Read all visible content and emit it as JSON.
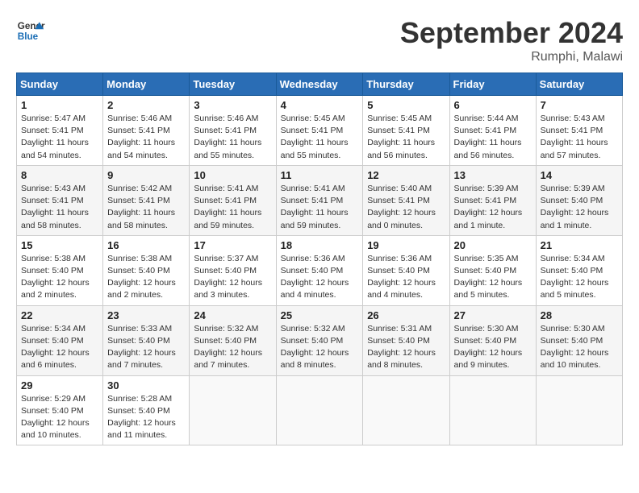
{
  "header": {
    "logo_line1": "General",
    "logo_line2": "Blue",
    "month": "September 2024",
    "location": "Rumphi, Malawi"
  },
  "weekdays": [
    "Sunday",
    "Monday",
    "Tuesday",
    "Wednesday",
    "Thursday",
    "Friday",
    "Saturday"
  ],
  "weeks": [
    [
      {
        "day": 1,
        "sunrise": "5:47 AM",
        "sunset": "5:41 PM",
        "daylight": "11 hours and 54 minutes."
      },
      {
        "day": 2,
        "sunrise": "5:46 AM",
        "sunset": "5:41 PM",
        "daylight": "11 hours and 54 minutes."
      },
      {
        "day": 3,
        "sunrise": "5:46 AM",
        "sunset": "5:41 PM",
        "daylight": "11 hours and 55 minutes."
      },
      {
        "day": 4,
        "sunrise": "5:45 AM",
        "sunset": "5:41 PM",
        "daylight": "11 hours and 55 minutes."
      },
      {
        "day": 5,
        "sunrise": "5:45 AM",
        "sunset": "5:41 PM",
        "daylight": "11 hours and 56 minutes."
      },
      {
        "day": 6,
        "sunrise": "5:44 AM",
        "sunset": "5:41 PM",
        "daylight": "11 hours and 56 minutes."
      },
      {
        "day": 7,
        "sunrise": "5:43 AM",
        "sunset": "5:41 PM",
        "daylight": "11 hours and 57 minutes."
      }
    ],
    [
      {
        "day": 8,
        "sunrise": "5:43 AM",
        "sunset": "5:41 PM",
        "daylight": "11 hours and 58 minutes."
      },
      {
        "day": 9,
        "sunrise": "5:42 AM",
        "sunset": "5:41 PM",
        "daylight": "11 hours and 58 minutes."
      },
      {
        "day": 10,
        "sunrise": "5:41 AM",
        "sunset": "5:41 PM",
        "daylight": "11 hours and 59 minutes."
      },
      {
        "day": 11,
        "sunrise": "5:41 AM",
        "sunset": "5:41 PM",
        "daylight": "11 hours and 59 minutes."
      },
      {
        "day": 12,
        "sunrise": "5:40 AM",
        "sunset": "5:41 PM",
        "daylight": "12 hours and 0 minutes."
      },
      {
        "day": 13,
        "sunrise": "5:39 AM",
        "sunset": "5:41 PM",
        "daylight": "12 hours and 1 minute."
      },
      {
        "day": 14,
        "sunrise": "5:39 AM",
        "sunset": "5:40 PM",
        "daylight": "12 hours and 1 minute."
      }
    ],
    [
      {
        "day": 15,
        "sunrise": "5:38 AM",
        "sunset": "5:40 PM",
        "daylight": "12 hours and 2 minutes."
      },
      {
        "day": 16,
        "sunrise": "5:38 AM",
        "sunset": "5:40 PM",
        "daylight": "12 hours and 2 minutes."
      },
      {
        "day": 17,
        "sunrise": "5:37 AM",
        "sunset": "5:40 PM",
        "daylight": "12 hours and 3 minutes."
      },
      {
        "day": 18,
        "sunrise": "5:36 AM",
        "sunset": "5:40 PM",
        "daylight": "12 hours and 4 minutes."
      },
      {
        "day": 19,
        "sunrise": "5:36 AM",
        "sunset": "5:40 PM",
        "daylight": "12 hours and 4 minutes."
      },
      {
        "day": 20,
        "sunrise": "5:35 AM",
        "sunset": "5:40 PM",
        "daylight": "12 hours and 5 minutes."
      },
      {
        "day": 21,
        "sunrise": "5:34 AM",
        "sunset": "5:40 PM",
        "daylight": "12 hours and 5 minutes."
      }
    ],
    [
      {
        "day": 22,
        "sunrise": "5:34 AM",
        "sunset": "5:40 PM",
        "daylight": "12 hours and 6 minutes."
      },
      {
        "day": 23,
        "sunrise": "5:33 AM",
        "sunset": "5:40 PM",
        "daylight": "12 hours and 7 minutes."
      },
      {
        "day": 24,
        "sunrise": "5:32 AM",
        "sunset": "5:40 PM",
        "daylight": "12 hours and 7 minutes."
      },
      {
        "day": 25,
        "sunrise": "5:32 AM",
        "sunset": "5:40 PM",
        "daylight": "12 hours and 8 minutes."
      },
      {
        "day": 26,
        "sunrise": "5:31 AM",
        "sunset": "5:40 PM",
        "daylight": "12 hours and 8 minutes."
      },
      {
        "day": 27,
        "sunrise": "5:30 AM",
        "sunset": "5:40 PM",
        "daylight": "12 hours and 9 minutes."
      },
      {
        "day": 28,
        "sunrise": "5:30 AM",
        "sunset": "5:40 PM",
        "daylight": "12 hours and 10 minutes."
      }
    ],
    [
      {
        "day": 29,
        "sunrise": "5:29 AM",
        "sunset": "5:40 PM",
        "daylight": "12 hours and 10 minutes."
      },
      {
        "day": 30,
        "sunrise": "5:28 AM",
        "sunset": "5:40 PM",
        "daylight": "12 hours and 11 minutes."
      },
      null,
      null,
      null,
      null,
      null
    ]
  ]
}
